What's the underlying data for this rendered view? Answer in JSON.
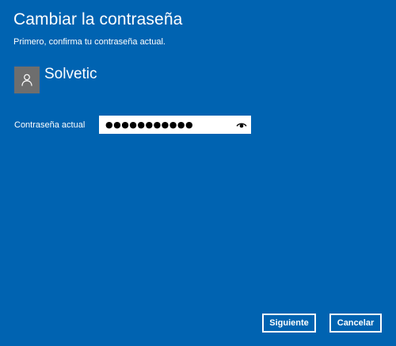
{
  "dialog": {
    "title": "Cambiar la contraseña",
    "subtitle": "Primero, confirma tu contraseña actual."
  },
  "user": {
    "name": "Solvetic",
    "avatar_icon": "person-icon"
  },
  "password_field": {
    "label": "Contraseña actual",
    "value": "●●●●●●●●●●●",
    "reveal_icon": "eye-icon"
  },
  "buttons": {
    "next_label": "Siguiente",
    "cancel_label": "Cancelar"
  },
  "colors": {
    "background": "#0063b1",
    "avatar_bg": "#6e6e6e",
    "text": "#ffffff"
  }
}
